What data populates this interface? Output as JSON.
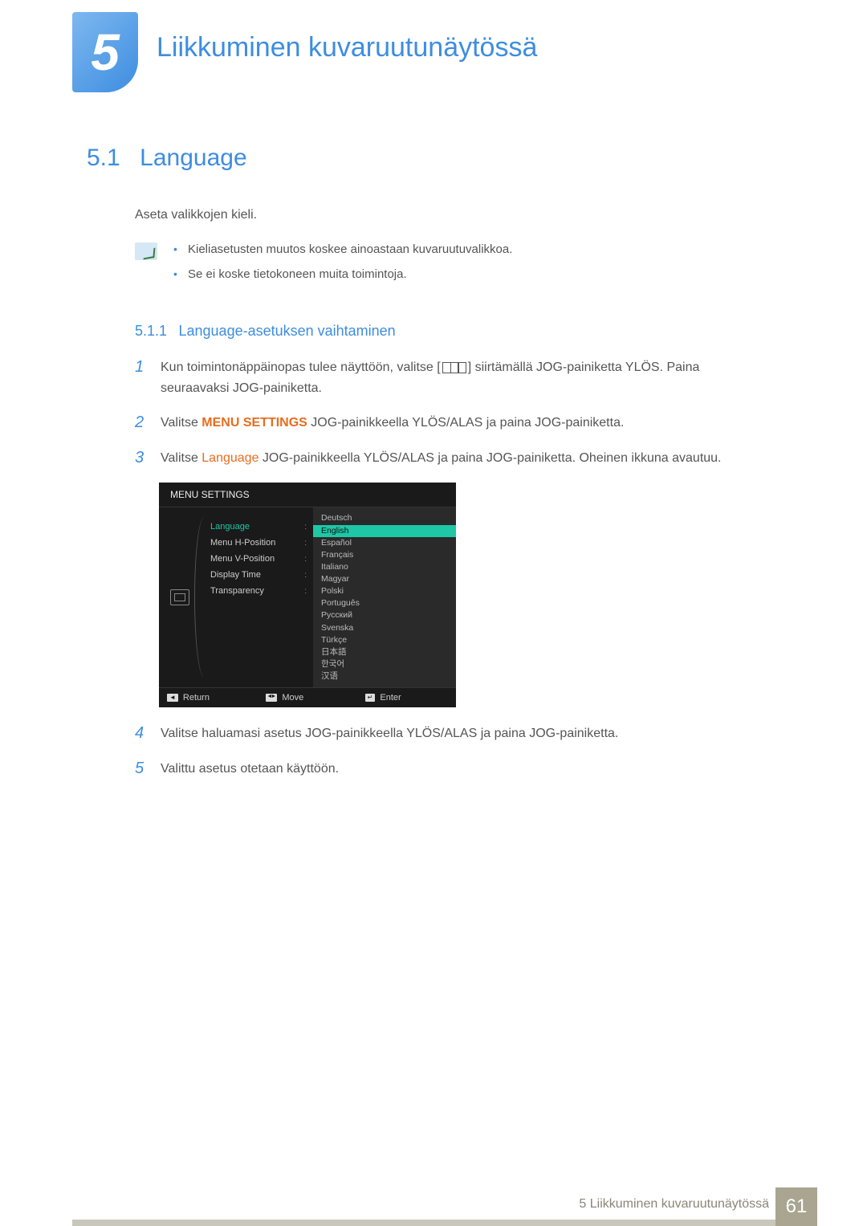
{
  "chapter": {
    "number": "5",
    "title": "Liikkuminen kuvaruutunäytössä"
  },
  "section": {
    "number": "5.1",
    "title": "Language",
    "intro": "Aseta valikkojen kieli."
  },
  "notes": [
    "Kieliasetusten muutos koskee ainoastaan kuvaruutuvalikkoa.",
    "Se ei koske tietokoneen muita toimintoja."
  ],
  "subsection": {
    "number": "5.1.1",
    "title": "Language-asetuksen vaihtaminen"
  },
  "steps": {
    "s1a": "Kun toimintonäppäinopas tulee näyttöön, valitse [",
    "s1b": "] siirtämällä JOG-painiketta YLÖS. Paina seuraavaksi JOG-painiketta.",
    "s2a": "Valitse ",
    "s2b": "MENU SETTINGS",
    "s2c": " JOG-painikkeella YLÖS/ALAS ja paina JOG-painiketta.",
    "s3a": "Valitse ",
    "s3b": "Language",
    "s3c": " JOG-painikkeella YLÖS/ALAS ja paina JOG-painiketta. Oheinen ikkuna avautuu.",
    "s4": "Valitse haluamasi asetus JOG-painikkeella YLÖS/ALAS ja paina JOG-painiketta.",
    "s5": "Valittu asetus otetaan käyttöön."
  },
  "osd": {
    "header": "MENU SETTINGS",
    "menu": [
      "Language",
      "Menu H-Position",
      "Menu V-Position",
      "Display Time",
      "Transparency"
    ],
    "langs": [
      "Deutsch",
      "English",
      "Español",
      "Français",
      "Italiano",
      "Magyar",
      "Polski",
      "Português",
      "Русский",
      "Svenska",
      "Türkçe",
      "日本語",
      "한국어",
      "汉语"
    ],
    "selected_lang": "English",
    "footer": {
      "return": "Return",
      "move": "Move",
      "enter": "Enter"
    }
  },
  "footer": {
    "text": "5 Liikkuminen kuvaruutunäytössä",
    "page": "61"
  }
}
